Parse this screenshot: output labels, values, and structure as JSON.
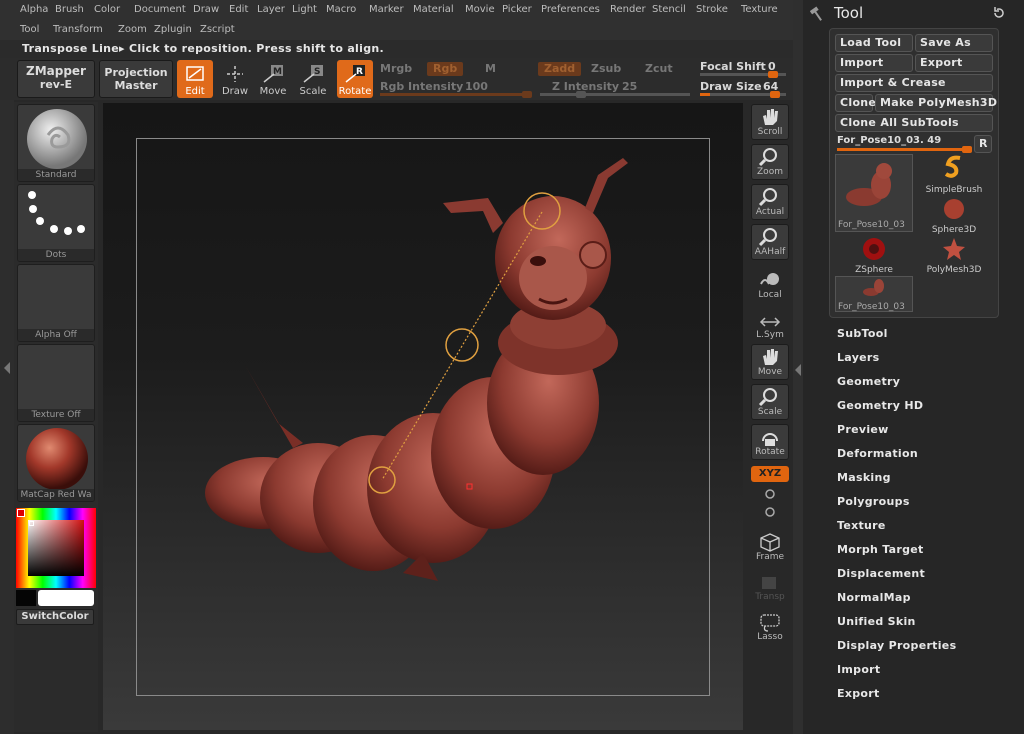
{
  "menus": {
    "row1": [
      "Alpha",
      "Brush",
      "Color",
      "Document",
      "Draw",
      "Edit",
      "Layer",
      "Light",
      "Macro",
      "Marker",
      "Material",
      "Movie",
      "Picker",
      "Preferences",
      "Render",
      "Stencil",
      "Stroke",
      "Texture"
    ],
    "row2": [
      "Tool",
      "Transform",
      "Zoom",
      "Zplugin",
      "Zscript"
    ]
  },
  "status_text": "Transpose Line▸ Click to reposition. Press shift to align.",
  "toolbar": {
    "zmapper_line1": "ZMapper",
    "zmapper_line2": "rev-E",
    "projection_line1": "Projection",
    "projection_line2": "Master",
    "edit": "Edit",
    "draw": "Draw",
    "move": "Move",
    "scale": "Scale",
    "rotate": "Rotate",
    "mrgb": "Mrgb",
    "rgb": "Rgb",
    "m": "M",
    "rgb_intensity_label": "Rgb Intensity",
    "rgb_intensity_value": "100",
    "zadd": "Zadd",
    "zsub": "Zsub",
    "zcut": "Zcut",
    "z_intensity_label": "Z Intensity",
    "z_intensity_value": "25",
    "focal_shift_label": "Focal Shift",
    "focal_shift_value": "0",
    "draw_size_label": "Draw Size",
    "draw_size_value": "64"
  },
  "left_shelf": {
    "standard": "Standard",
    "dots": "Dots",
    "alpha_off": "Alpha Off",
    "texture_off": "Texture Off",
    "matcap": "MatCap Red Wa",
    "switch_color": "SwitchColor"
  },
  "right_shelf": [
    "Scroll",
    "Zoom",
    "Actual",
    "AAHalf",
    "Local",
    "L.Sym",
    "Move",
    "Scale",
    "Rotate",
    "XYZ",
    "Frame",
    "Transp",
    "Lasso"
  ],
  "tool_panel": {
    "title": "Tool",
    "load_tool": "Load Tool",
    "save_as": "Save As",
    "import": "Import",
    "export": "Export",
    "import_crease": "Import & Crease",
    "clone": "Clone",
    "make_polymesh": "Make PolyMesh3D",
    "clone_all": "Clone All SubTools",
    "current_tool": "For_Pose10_03. 49",
    "r_button": "R",
    "thumbs": [
      "For_Pose10_03",
      "SimpleBrush",
      "Sphere3D",
      "ZSphere",
      "PolyMesh3D",
      "For_Pose10_03"
    ]
  },
  "submenus": [
    "SubTool",
    "Layers",
    "Geometry",
    "Geometry HD",
    "Preview",
    "Deformation",
    "Masking",
    "Polygroups",
    "Texture",
    "Morph Target",
    "Displacement",
    "NormalMap",
    "Unified Skin",
    "Display Properties",
    "Import",
    "Export"
  ],
  "colors": {
    "accent": "#e0650f",
    "model": "#8b3a32"
  }
}
